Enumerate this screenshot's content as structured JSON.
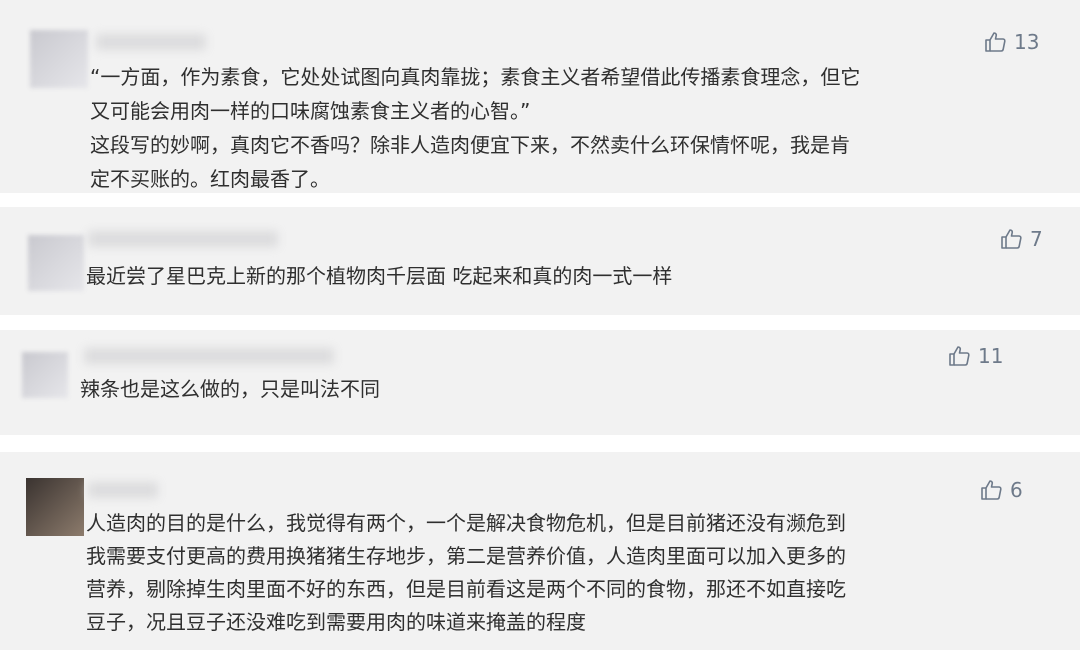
{
  "comments": [
    {
      "likes": "13",
      "lines": [
        "“一方面，作为素食，它处处试图向真肉靠拢；素食主义者希望借此传播素食理念，但它",
        "又可能会用肉一样的口味腐蚀素食主义者的心智。”",
        "这段写的妙啊，真肉它不香吗？除非人造肉便宜下来，不然卖什么环保情怀呢，我是肯",
        "定不买账的。红肉最香了。"
      ]
    },
    {
      "likes": "7",
      "lines": [
        "最近尝了星巴克上新的那个植物肉千层面 吃起来和真的肉一式一样"
      ]
    },
    {
      "likes": "11",
      "lines": [
        "辣条也是这么做的，只是叫法不同"
      ]
    },
    {
      "likes": "6",
      "lines": [
        "人造肉的目的是什么，我觉得有两个，一个是解决食物危机，但是目前猪还没有濒危到",
        "我需要支付更高的费用换猪猪生存地步，第二是营养价值，人造肉里面可以加入更多的",
        "营养，剔除掉生肉里面不好的东西，但是目前看这是两个不同的食物，那还不如直接吃",
        "豆子，况且豆子还没难吃到需要用肉的味道来掩盖的程度"
      ]
    }
  ],
  "icons": {
    "like": "thumbs-up-icon"
  },
  "colors": {
    "card_bg": "#f2f2f2",
    "like": "#6e7a8a",
    "text": "#2f2f2f"
  }
}
